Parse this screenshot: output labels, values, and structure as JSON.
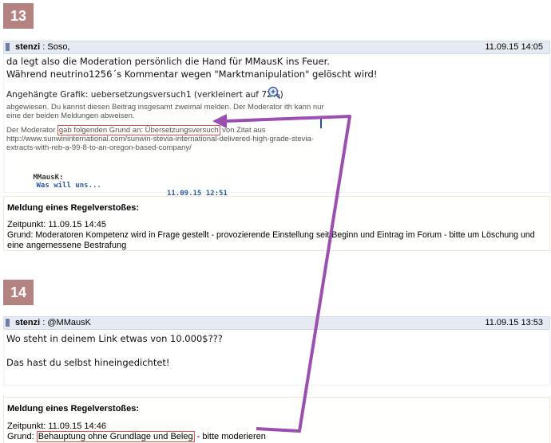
{
  "post13": {
    "number": "13",
    "author": "stenzi",
    "reply_to": "Soso,",
    "date": "11.09.15 14:05",
    "line1": "da legt also die Moderation persönlich die Hand für MMausK ins Feuer.",
    "line2": "Während neutrino1256´s Kommentar wegen \"Marktmanipulation\" gelöscht wird!",
    "attachment_label": "Angehängte Grafik: uebersetzungsversuch1 (verkleinert auf 72%)",
    "zoom_icon": "magnifier-plus-icon",
    "quote_line1": "abgewiesen. Du kannst diesen Beitrag insgesamt zweimal melden. Der Moderator ith kann nur",
    "quote_line2": "eine der beiden Meldungen abweisen.",
    "quote_reason_prefix": "Der Moderator ",
    "quote_reason_highlight": "gab folgenden Grund an: Übersetzungsversuch",
    "quote_reason_suffix": " von Zitat aus",
    "quote_url1": "http://www.sunwininternational.com/sunwin-stevia-international-delivered-high-grade-stevia-",
    "quote_url2": "extracts-with-reb-a-99-8-to-an-oregon-based-company/",
    "quote_author": "MMausK:",
    "quote_link": "Was will uns...",
    "quote_date": "11.09.15 12:51"
  },
  "report13": {
    "title": "Meldung eines Regelverstoßes:",
    "time": "Zeitpunkt: 11.09.15 14:45",
    "reason1": "Grund: Moderatoren Kompetenz wird in Frage gestellt - provozierende Einstellung seit Beginn und Eintrag im Forum - bitte um Löschung und",
    "reason2": "eine angemessene Bestrafung"
  },
  "post14": {
    "number": "14",
    "author": "stenzi",
    "reply_to": "@MMausK",
    "date": "11.09.15 13:53",
    "line1": "Wo steht in deinem Link etwas von 10.000$???",
    "line2": "Das hast du selbst hineingedichtet!"
  },
  "report14": {
    "title": "Meldung eines Regelverstoßes:",
    "time": "Zeitpunkt: 11.09.15 14:46",
    "reason_prefix": "Grund: ",
    "reason_highlight": "Behauptung ohne Grundlage und Beleg",
    "reason_suffix": " - bitte moderieren"
  },
  "colors": {
    "badge": "#b58282",
    "header_bg": "#e6ebf3",
    "arrow": "#9b4fb0",
    "highlight_border": "#d9534f"
  }
}
